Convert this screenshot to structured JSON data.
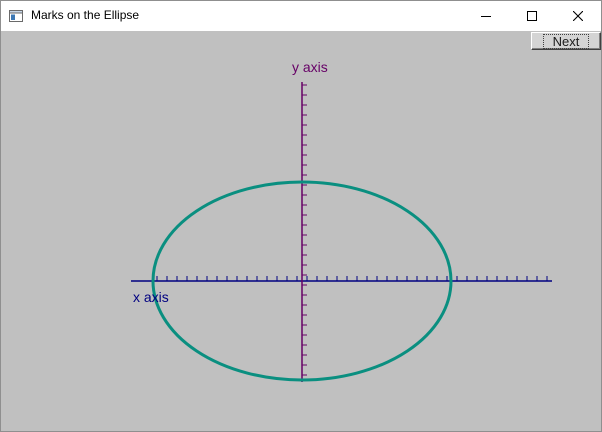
{
  "window": {
    "title": "Marks on the Ellipse",
    "controls": {
      "minimize": "minimize-icon",
      "maximize": "maximize-icon",
      "close": "close-icon"
    }
  },
  "toolbar": {
    "next_label": "Next"
  },
  "plot": {
    "x_axis_label": "x axis",
    "y_axis_label": "y axis",
    "x_axis_color": "#000080",
    "y_axis_color": "#660066",
    "ellipse_color": "#0a8f80",
    "background": "#c0c0c0"
  }
}
